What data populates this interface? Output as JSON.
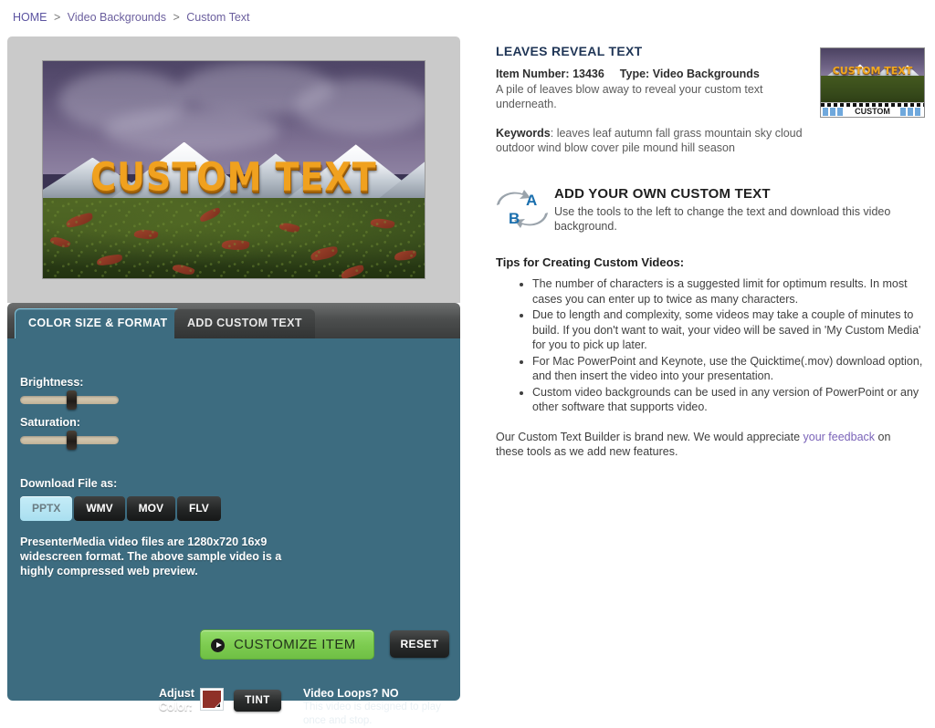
{
  "breadcrumb": {
    "home": "HOME",
    "sep": ">",
    "level2": "Video Backgrounds",
    "level3": "Custom Text"
  },
  "preview": {
    "text": "CUSTOM  TEXT",
    "alt": "Leaves reveal text video preview"
  },
  "tabs": [
    {
      "label": "COLOR SIZE & FORMAT",
      "active": true
    },
    {
      "label": "ADD CUSTOM TEXT",
      "active": false
    }
  ],
  "controls": {
    "brightness_label": "Brightness:",
    "saturation_label": "Saturation:",
    "brightness_value": 47,
    "saturation_value": 47,
    "adjust_color_label": "Adjust\nColor:",
    "adjust_color_line1": "Adjust",
    "adjust_color_line2": "Color:",
    "swatch_color": "#8f3028",
    "tint_label": "TINT",
    "loops_question": "Video Loops? ",
    "loops_answer": "NO",
    "loops_desc": "This video is designed to play once and stop.",
    "download_label": "Download File as:",
    "formats": [
      {
        "label": "PPTX",
        "selected": true
      },
      {
        "label": "WMV",
        "selected": false
      },
      {
        "label": "MOV",
        "selected": false
      },
      {
        "label": "FLV",
        "selected": false
      }
    ],
    "format_note": "PresenterMedia video files are 1280x720 16x9 widescreen format. The above sample video is a highly compressed web preview.",
    "customize_label": "CUSTOMIZE ITEM",
    "reset_label": "RESET"
  },
  "item": {
    "title": "LEAVES REVEAL TEXT",
    "item_number_label": "Item Number:",
    "item_number": "13436",
    "type_label": "Type:",
    "type_value": "Video Backgrounds",
    "description": "A pile of leaves blow away to reveal your custom text underneath.",
    "keywords_label": "Keywords",
    "keywords": ": leaves leaf autumn fall grass mountain sky cloud outdoor wind blow cover pile mound hill season",
    "thumb_text": "CUSTOM TEXT",
    "thumb_caption": "CUSTOM"
  },
  "promo": {
    "heading": "ADD YOUR OWN CUSTOM TEXT",
    "description": "Use the tools to the left to change the text and download this video background.",
    "icon_letter_a": "A",
    "icon_letter_b": "B"
  },
  "tips": {
    "title": "Tips for Creating Custom Videos:",
    "items": [
      "The number of characters is a suggested limit for optimum results. In most cases you can enter up to twice as many characters.",
      "Due to length and complexity, some videos may take a couple of minutes to build. If you don't want to wait, your video will be saved in 'My Custom Media' for you to pick up later.",
      "For Mac PowerPoint and Keynote, use the Quicktime(.mov) download option, and then insert the video into your presentation.",
      "Custom video backgrounds can be used in any version of PowerPoint or any other software that supports video."
    ]
  },
  "closing": {
    "part1": "Our Custom Text Builder is brand new. We would appreciate ",
    "link": "your feedback",
    "part2": " on these tools as we add new features."
  },
  "colors": {
    "panel_teal": "#3d6c80",
    "accent_green": "#7ccb4f",
    "link_purple": "#6b5f9e",
    "title_navy": "#1f3556",
    "swatch_red": "#8f3028"
  }
}
